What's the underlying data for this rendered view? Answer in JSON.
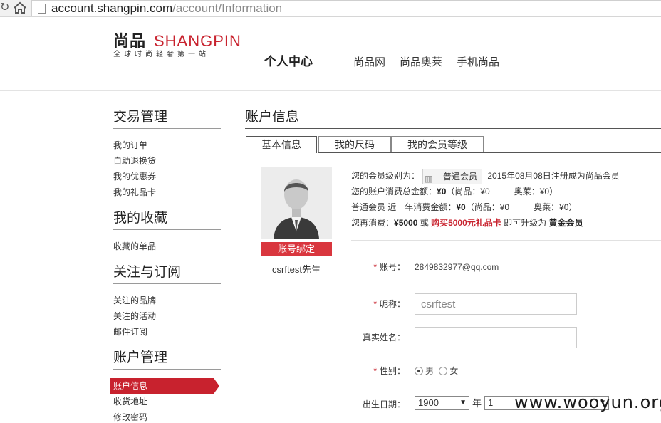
{
  "browser": {
    "url_host": "account.shangpin.com",
    "url_path": "/account/Information"
  },
  "header": {
    "logo_cn": "尚品",
    "logo_en": "SHANGPIN",
    "logo_tagline": "全球时尚轻奢第一站",
    "center_title": "个人中心",
    "nav": [
      "尚品网",
      "尚品奥莱",
      "手机尚品"
    ]
  },
  "sidebar": {
    "groups": [
      {
        "title": "交易管理",
        "items": [
          "我的订单",
          "自助退换货",
          "我的优惠券",
          "我的礼品卡"
        ]
      },
      {
        "title": "我的收藏",
        "items": [
          "收藏的单品"
        ]
      },
      {
        "title": "关注与订阅",
        "items": [
          "关注的品牌",
          "关注的活动",
          "邮件订阅"
        ]
      },
      {
        "title": "账户管理",
        "items": [
          "账户信息",
          "收货地址",
          "修改密码"
        ]
      }
    ]
  },
  "main": {
    "title": "账户信息",
    "tabs": [
      "基本信息",
      "我的尺码",
      "我的会员等级"
    ],
    "bind_button": "账号绑定",
    "username": "csrftest先生",
    "member": {
      "level_prefix": "您的会员级别为：",
      "level": "普通会员",
      "registered": "2015年08月08日注册成为尚品会员",
      "total_prefix": "您的账户消费总金额：",
      "total_amount": "¥0",
      "total_paren_open": "（尚品：¥0",
      "total_outlet": "奥莱：¥0）",
      "year_prefix": "普通会员 近一年消费金额：",
      "year_amount": "¥0",
      "year_paren_open": "（尚品：¥0",
      "year_outlet": "奥莱：¥0）",
      "upgrade_prefix": "您再消费：",
      "upgrade_amount": "¥5000",
      "upgrade_or": " 或 ",
      "upgrade_gift": "购买5000元礼品卡",
      "upgrade_mid": " 即可升级为 ",
      "upgrade_level": "黄金会员"
    },
    "form": {
      "account_label": "账号：",
      "account_value": "2849832977@qq.com",
      "nickname_label": "昵称：",
      "nickname_value": "csrftest",
      "realname_label": "真实姓名：",
      "realname_value": "",
      "gender_label": "性别：",
      "gender_male": "男",
      "gender_female": "女",
      "birthday_label": "出生日期：",
      "birth_year": "1900",
      "year_unit": "年",
      "birth_month": "1"
    }
  },
  "watermark": "www.wooyun.org"
}
